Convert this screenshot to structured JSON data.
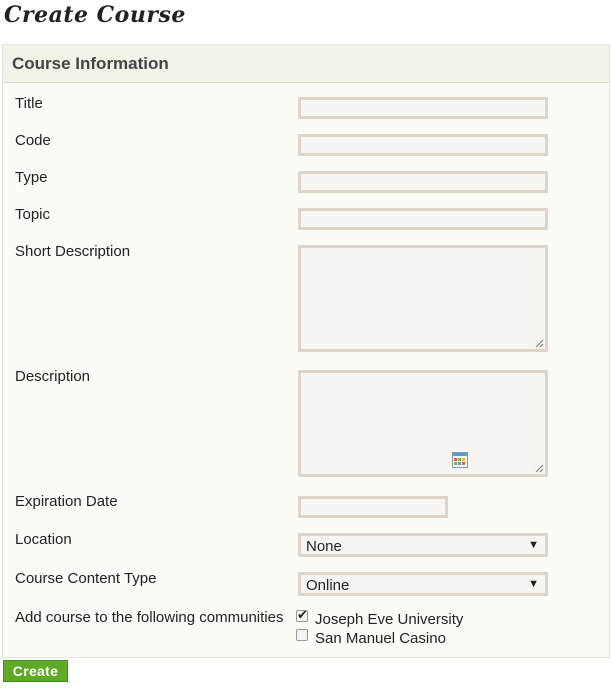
{
  "page": {
    "title": "Create Course"
  },
  "panel": {
    "title": "Course Information"
  },
  "fields": {
    "title": {
      "label": "Title",
      "value": ""
    },
    "code": {
      "label": "Code",
      "value": ""
    },
    "type": {
      "label": "Type",
      "value": ""
    },
    "topic": {
      "label": "Topic",
      "value": ""
    },
    "short_description": {
      "label": "Short Description",
      "value": ""
    },
    "description": {
      "label": "Description",
      "value": ""
    },
    "expiration_date": {
      "label": "Expiration Date",
      "value": "",
      "icon": "calendar-icon"
    },
    "location": {
      "label": "Location",
      "selected": "None"
    },
    "content_type": {
      "label": "Course Content Type",
      "selected": "Online"
    },
    "communities": {
      "label": "Add course to the following communities",
      "options": [
        {
          "label": "Joseph Eve University",
          "checked": true
        },
        {
          "label": "San Manuel Casino",
          "checked": false
        }
      ]
    }
  },
  "actions": {
    "create_label": "Create"
  },
  "colors": {
    "button_green": "#5fa924",
    "field_border": "#dcd5c8",
    "panel_bg": "#fbfcf5",
    "header_bg": "#f2f2e8"
  }
}
